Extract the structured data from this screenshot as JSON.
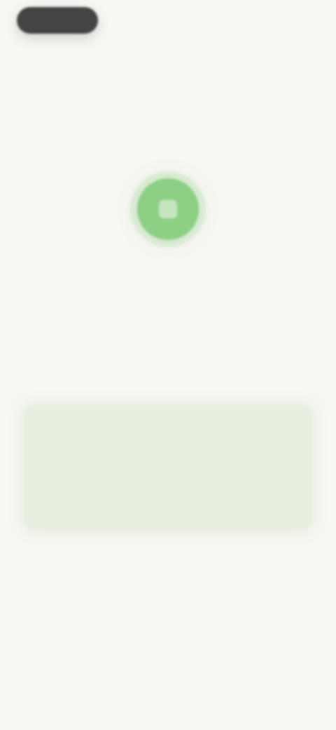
{
  "top_pill": {
    "label": ""
  },
  "status": {
    "icon": "check-circle-icon",
    "accent_color": "#8dcf85",
    "title": "",
    "description": ""
  },
  "card": {
    "line1": "",
    "line2": "",
    "subtext": "",
    "background_color": "#e6efe0"
  }
}
